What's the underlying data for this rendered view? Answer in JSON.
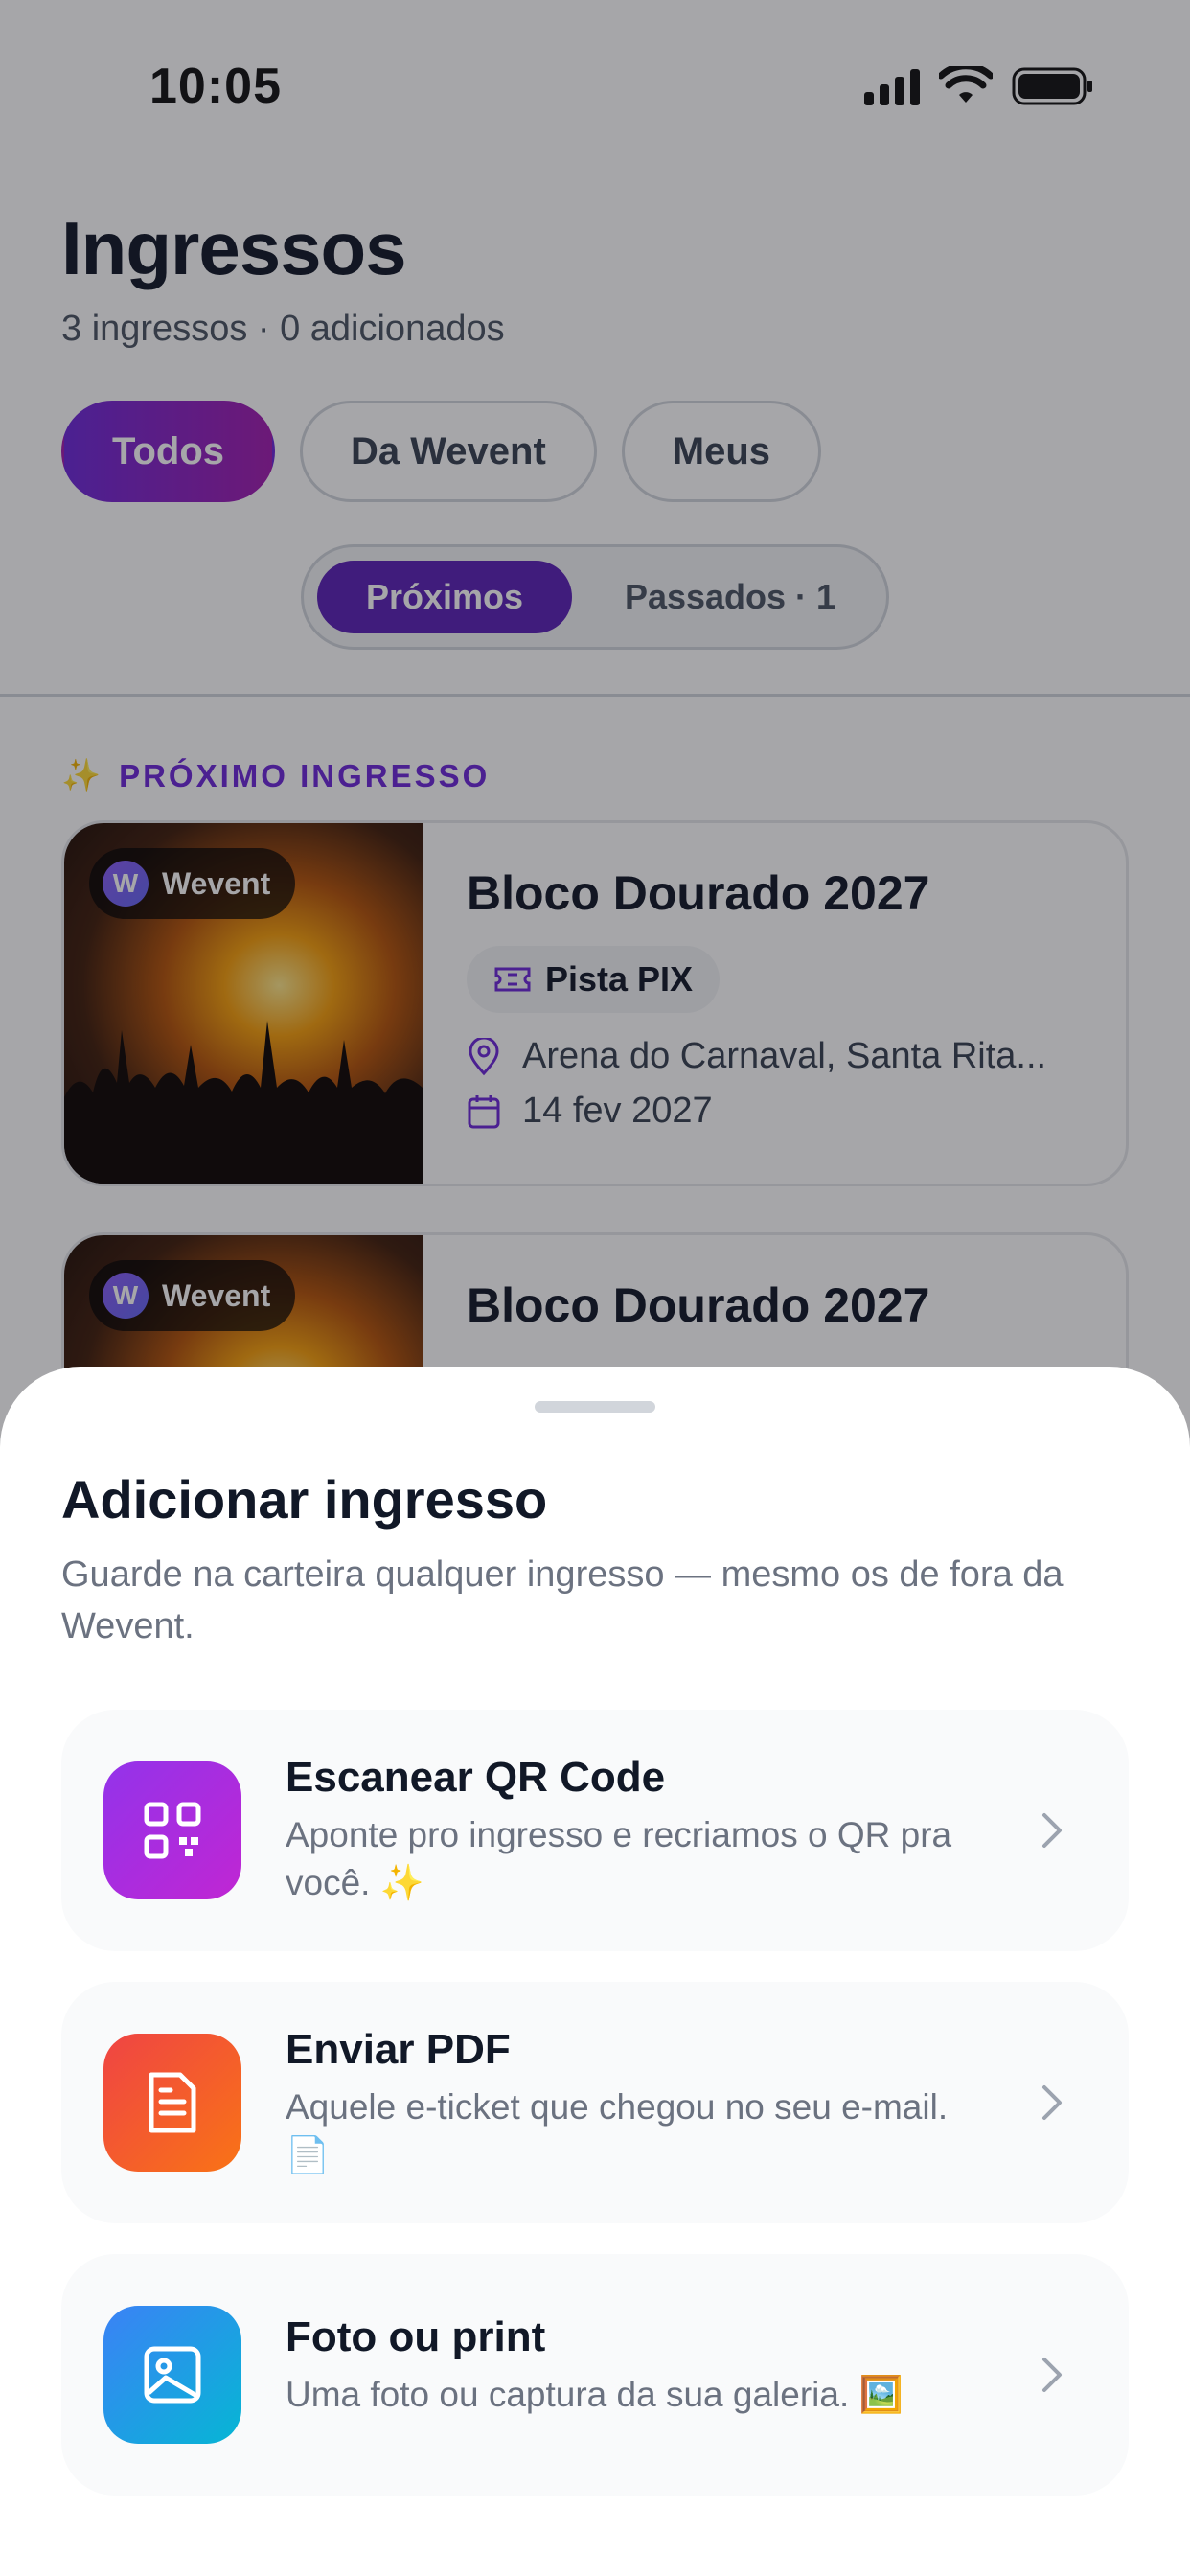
{
  "status_bar": {
    "time": "10:05"
  },
  "header": {
    "title": "Ingressos",
    "subtitle": "3 ingressos · 0 adicionados"
  },
  "filters": [
    {
      "label": "Todos",
      "active": true
    },
    {
      "label": "Da Wevent",
      "active": false
    },
    {
      "label": "Meus",
      "active": false
    }
  ],
  "segment": {
    "upcoming": "Próximos",
    "past": "Passados · 1"
  },
  "section": {
    "label": "PRÓXIMO INGRESSO",
    "emoji": "✨"
  },
  "tickets": [
    {
      "badge": "Wevent",
      "title": "Bloco Dourado 2027",
      "type": "Pista PIX",
      "location": "Arena do Carnaval, Santa Rita...",
      "date": "14 fev 2027"
    },
    {
      "badge": "Wevent",
      "title": "Bloco Dourado 2027"
    }
  ],
  "sheet": {
    "title": "Adicionar ingresso",
    "subtitle": "Guarde na carteira qualquer ingresso — mesmo os de fora da Wevent.",
    "options": [
      {
        "title": "Escanear QR Code",
        "description": "Aponte pro ingresso e recriamos o QR pra você. ✨",
        "icon": "qr-code-icon",
        "color_from": "#9333ea",
        "color_to": "#c026d3"
      },
      {
        "title": "Enviar PDF",
        "description": "Aquele e-ticket que chegou no seu e-mail. 📄",
        "icon": "document-icon",
        "color_from": "#ef4444",
        "color_to": "#f97316"
      },
      {
        "title": "Foto ou print",
        "description": "Uma foto ou captura da sua galeria. 🖼️",
        "icon": "image-icon",
        "color_from": "#3b82f6",
        "color_to": "#06b6d4"
      }
    ]
  },
  "colors": {
    "accent": "#6d28d9",
    "accent_alt": "#a21caf"
  }
}
